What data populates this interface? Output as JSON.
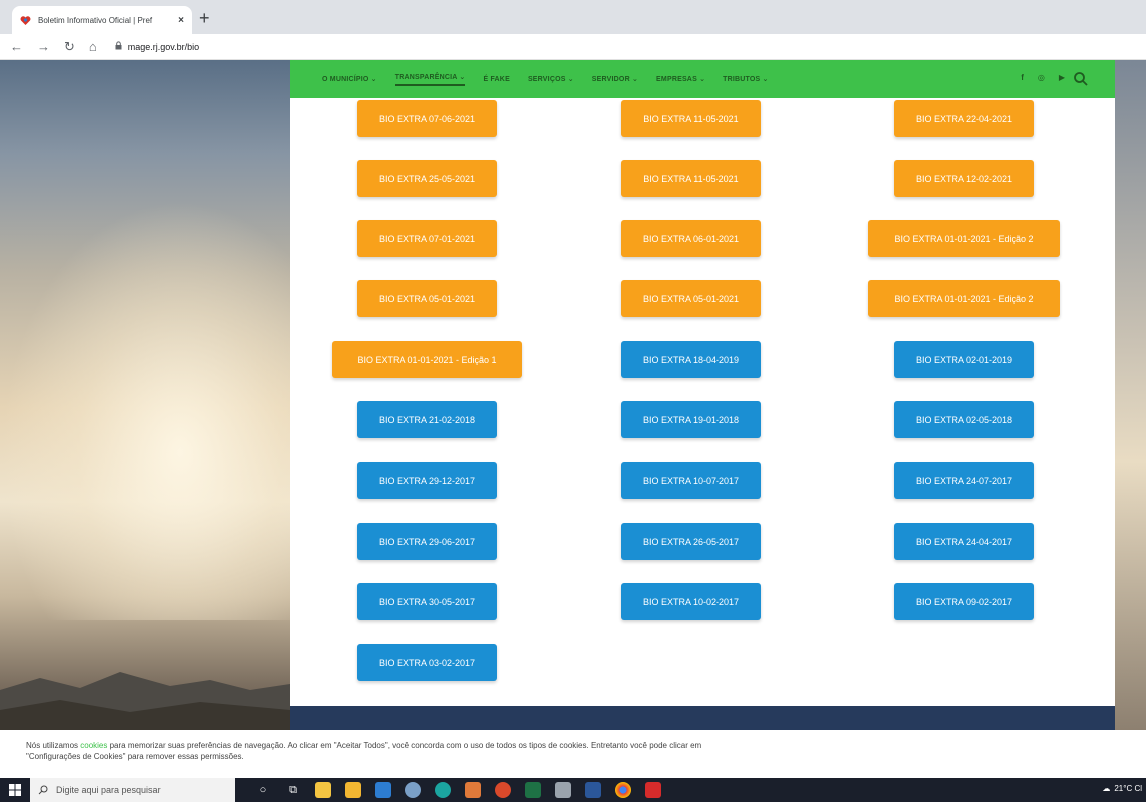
{
  "browser": {
    "tab_title": "Boletim Informativo Oficial | Pref",
    "url": "mage.rj.gov.br/bio"
  },
  "nav": {
    "items": [
      "O MUNICÍPIO ⌄",
      "TRANSPARÊNCIA ⌄",
      "É FAKE",
      "SERVIÇOS ⌄",
      "SERVIDOR ⌄",
      "EMPRESAS ⌄",
      "TRIBUTOS ⌄"
    ],
    "social": [
      "f",
      "◎",
      "▶"
    ]
  },
  "colors": {
    "orange_button": "#f8a11b",
    "blue_button": "#1b8fd3",
    "nav_green": "#3ec14a",
    "footer_navy": "#263a5c"
  },
  "buttons": [
    {
      "label": "BIO EXTRA 07-06-2021",
      "color": "orange"
    },
    {
      "label": "BIO EXTRA 11-05-2021",
      "color": "orange"
    },
    {
      "label": "BIO EXTRA 22-04-2021",
      "color": "orange"
    },
    {
      "label": "BIO EXTRA 25-05-2021",
      "color": "orange"
    },
    {
      "label": "BIO EXTRA 11-05-2021",
      "color": "orange"
    },
    {
      "label": "BIO EXTRA 12-02-2021",
      "color": "orange"
    },
    {
      "label": "BIO EXTRA 07-01-2021",
      "color": "orange"
    },
    {
      "label": "BIO EXTRA 06-01-2021",
      "color": "orange"
    },
    {
      "label": "BIO EXTRA 01-01-2021 - Edição 2",
      "color": "orange"
    },
    {
      "label": "BIO EXTRA 05-01-2021",
      "color": "orange"
    },
    {
      "label": "BIO EXTRA 05-01-2021",
      "color": "orange"
    },
    {
      "label": "BIO EXTRA 01-01-2021 - Edição 2",
      "color": "orange"
    },
    {
      "label": "BIO EXTRA 01-01-2021 - Edição 1",
      "color": "orange"
    },
    {
      "label": "BIO EXTRA 18-04-2019",
      "color": "blue"
    },
    {
      "label": "BIO EXTRA 02-01-2019",
      "color": "blue"
    },
    {
      "label": "BIO EXTRA 21-02-2018",
      "color": "blue"
    },
    {
      "label": "BIO EXTRA 19-01-2018",
      "color": "blue"
    },
    {
      "label": "BIO EXTRA 02-05-2018",
      "color": "blue"
    },
    {
      "label": "BIO EXTRA 29-12-2017",
      "color": "blue"
    },
    {
      "label": "BIO EXTRA 10-07-2017",
      "color": "blue"
    },
    {
      "label": "BIO EXTRA 24-07-2017",
      "color": "blue"
    },
    {
      "label": "BIO EXTRA 29-06-2017",
      "color": "blue"
    },
    {
      "label": "BIO EXTRA 26-05-2017",
      "color": "blue"
    },
    {
      "label": "BIO EXTRA 24-04-2017",
      "color": "blue"
    },
    {
      "label": "BIO EXTRA 30-05-2017",
      "color": "blue"
    },
    {
      "label": "BIO EXTRA 10-02-2017",
      "color": "blue"
    },
    {
      "label": "BIO EXTRA 09-02-2017",
      "color": "blue"
    },
    {
      "label": "BIO EXTRA 03-02-2017",
      "color": "blue"
    }
  ],
  "cookie": {
    "text_before": "Nós utilizamos ",
    "link": "cookies",
    "text_after": " para memorizar suas preferências de navegação. Ao clicar em \"Aceitar Todos\", você concorda com o uso de todos os tipos de cookies. Entretanto você pode clicar em",
    "line2": "\"Configurações de Cookies\" para remover essas permissões."
  },
  "taskbar": {
    "search_placeholder": "Digite aqui para pesquisar",
    "weather": "21°C Cl"
  }
}
